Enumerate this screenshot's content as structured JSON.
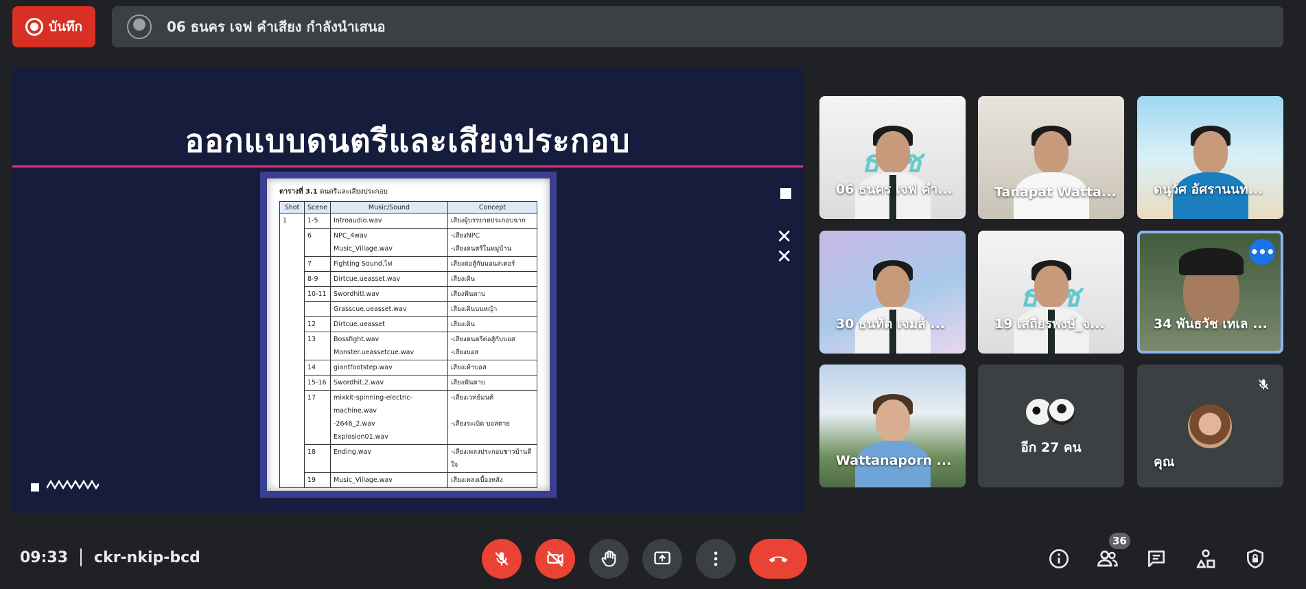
{
  "top_bar": {
    "record_label": "บันทึก",
    "presenter_text": "06 ธนคร เจฟ คำเสียง กำลังนำเสนอ"
  },
  "slide": {
    "title": "ออกแบบดนตรีและเสียงประกอบ",
    "deco_x": "✕",
    "doc": {
      "caption_bold": "ตารางที่ 3.1",
      "caption_rest": "ดนตรีและเสียงประกอบ",
      "headers": [
        "Shot",
        "Scene",
        "Music/Sound",
        "Concept"
      ],
      "shot_1": "1",
      "rows": [
        {
          "scene": "1-5",
          "music": [
            "Introaudio.wav"
          ],
          "concept": [
            "เสียงผู้บรรยายประกอบฉาก"
          ]
        },
        {
          "scene": "6",
          "music": [
            "NPC_4wav",
            "Music_Village.wav"
          ],
          "concept": [
            "-เสียงNPC",
            "-เสียงดนตรีในหมู่บ้าน"
          ]
        },
        {
          "scene": "7",
          "music": [
            "Fighting Sound.ไฟ"
          ],
          "concept": [
            "เสียงต่อสู้กับมอนสเตอร์"
          ]
        },
        {
          "scene": "8-9",
          "music": [
            "Dirtcue.ueasset.wav"
          ],
          "concept": [
            "เสียงเดิน"
          ]
        },
        {
          "scene": "10-11",
          "music": [
            "Swordhitl.wav"
          ],
          "concept": [
            "เสียงฟันดาบ"
          ]
        },
        {
          "scene": "",
          "music": [
            "Grasscue.ueasset.wav"
          ],
          "concept": [
            "เสียงเดินบนหญ้า"
          ]
        },
        {
          "scene": "12",
          "music": [
            "Dirtcue.ueasset"
          ],
          "concept": [
            "เสียงเดิน"
          ]
        },
        {
          "scene": "13",
          "music": [
            "Bossfight.wav",
            "Monster.ueassetcue.wav"
          ],
          "concept": [
            "-เสียงดนตรีต่อสู้กับบอส",
            "-เสียงบอส"
          ]
        },
        {
          "scene": "14",
          "music": [
            "giantfootstep.wav"
          ],
          "concept": [
            "เสียงเท้าบอส"
          ]
        },
        {
          "scene": "15-16",
          "music": [
            "Swordhit.2.wav"
          ],
          "concept": [
            "เสียงฟันดาบ"
          ]
        },
        {
          "scene": "17",
          "music": [
            "mixkit-spinning-electric-",
            "machine.wav",
            "-2646_2.wav",
            "Explosion01.wav"
          ],
          "concept": [
            "-เสียงเวทย์มนต์",
            "",
            "-เสียงระเบิด บอสตาย",
            ""
          ]
        },
        {
          "scene": "18",
          "music": [
            "Ending.wav"
          ],
          "concept": [
            "-เสียงเพลงประกอบชาวบ้านดี",
            "ใจ"
          ]
        },
        {
          "scene": "19",
          "music": [
            "Music_Village.wav"
          ],
          "concept": [
            "เสียงเพลงเบื้องหลัง"
          ]
        }
      ]
    }
  },
  "participants": {
    "p1": "06 ธนคร เจฟ คำ...",
    "p2": "Tanapat Watta...",
    "p3": "ดนุวัศ อัศรานนท...",
    "p4": "30 ธนทัต เจมส์ ...",
    "p5": "19 เสถียรพงษ์_จ...",
    "p6": "34 พันธวัช เทเล ...",
    "p7": "Wattanaporn ...",
    "others": "อีก 27 คน",
    "self": "คุณ",
    "logo_text": "ธวัช",
    "more": "•••"
  },
  "bottom_bar": {
    "time": "09:33",
    "meeting_code": "ckr-nkip-bcd",
    "people_count": "36"
  },
  "colors": {
    "record_red": "#d93025",
    "control_red": "#ea4335",
    "active_blue": "#8ab4f8",
    "slide_bg": "#161d3c",
    "slide_accent": "#e0357d"
  }
}
